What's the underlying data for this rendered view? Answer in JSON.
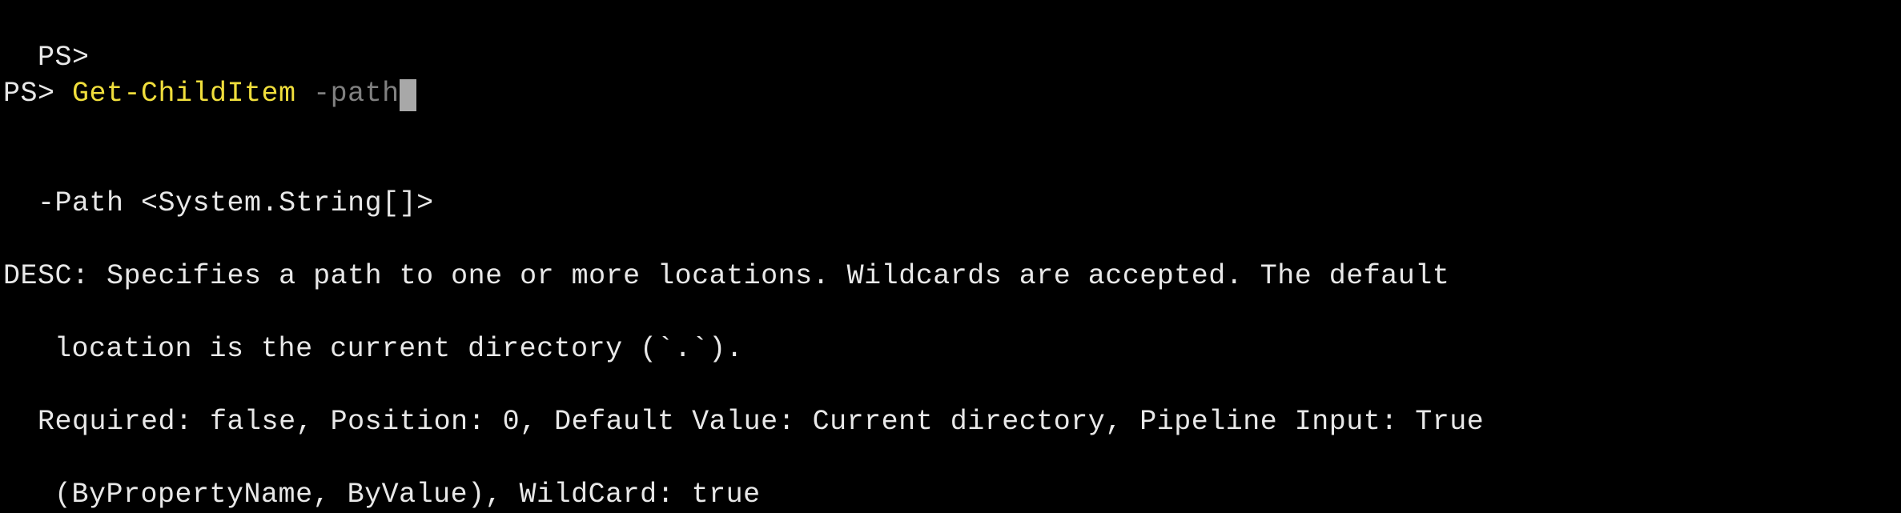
{
  "terminal": {
    "line1": {
      "prompt": "PS>"
    },
    "line2": {
      "prompt": "PS> ",
      "command": "Get-ChildItem ",
      "param": "-path"
    },
    "paramHelp": {
      "signature": "-Path <System.String[]>",
      "descLabel": "DESC: ",
      "descText": "Specifies a path to one or more locations. Wildcards are accepted. The default",
      "descTextCont": "location is the current directory (`.`).",
      "attributes": "Required: false, Position: 0, Default Value: Current directory, Pipeline Input: True",
      "attributesCont": "(ByPropertyName, ByValue), WildCard: true"
    }
  }
}
